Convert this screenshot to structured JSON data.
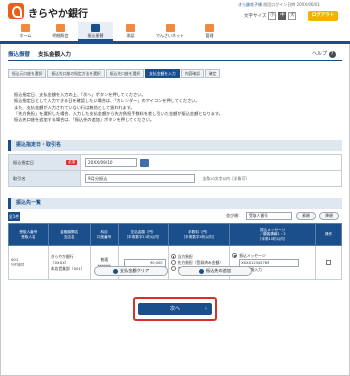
{
  "header": {
    "bank_name": "きらやか銀行",
    "user_name": "きら銀花子様",
    "last_login": "前回ログイン日時 20XX/06/01",
    "font_size_label": "文字サイズ",
    "font_sizes": [
      "小",
      "中",
      "大"
    ],
    "logout_label": "ログアウト"
  },
  "nav": {
    "items": [
      {
        "label": "ホーム",
        "icon": "home-icon"
      },
      {
        "label": "明細照会",
        "icon": "statement-icon"
      },
      {
        "label": "振込振替",
        "icon": "transfer-icon"
      },
      {
        "label": "承認",
        "icon": "approval-icon"
      },
      {
        "label": "でんさいネット",
        "icon": "densai-icon"
      },
      {
        "label": "管理",
        "icon": "admin-icon"
      }
    ]
  },
  "page": {
    "code": "振込振替",
    "title": "支払金額入力",
    "help_label": "ヘルプ"
  },
  "steps": [
    "振込元口座を選択",
    "振込先口座の指定方法を選択",
    "振込先口座を選択",
    "支払金額を入力",
    "内容確認",
    "確定"
  ],
  "instructions": [
    "振込指定日、支払金額を入力の上、「次へ」ボタンを押してください。",
    "振込指定日として入力できる日を確認したい場合は、「カレンダー」のアイコンを押してください。",
    "また、支払金額が入力されていない行は無効として扱われます。",
    "「先方負担」を選択した場合、入力した支払金額から先方負担手数料を差し引いた金額が振込金額となります。",
    "振込先口座を追加する場合は、「振込先の追加」ボタンを押してください。"
  ],
  "section_date": {
    "title": "振込指定日・取引名",
    "date_label": "振込指定日",
    "required_label": "必須",
    "date_value": "20XX/09/10",
    "txn_label": "取引名",
    "txn_value": "9月分振込",
    "txn_note": "全角10文字以内［半角可］"
  },
  "section_list": {
    "title": "振込先一覧",
    "all_label": "全1件",
    "sort_label": "並び順：",
    "sort_value": "受取人番号",
    "asc_label": "昇順",
    "desc_label": "降順",
    "headers": [
      "受取人番号\n受取人名",
      "金融機関名\n支店名",
      "科目\n口座番号",
      "支払金額（円）\n［半角数字11桁以内］",
      "手数料（円）\n［半角数字4桁以内］",
      "振込メッセージ\n／顧客情報1・2\n［半角10桁以内］",
      "操作"
    ],
    "rows": [
      {
        "receiver_no": "001",
        "receiver_name": "ｷﾗﾔｶﾀﾛｳ",
        "bank_name": "きらやか銀行（0XXX）",
        "branch_name": "本店営業部（001）",
        "account_type": "普通",
        "account_no": "*******",
        "amount": "90,000",
        "fee_option_1": "当方負担",
        "fee_option_2": "先方負担（登録済み金額）",
        "fee_option_3": "先方負担（指定金額）",
        "message_option_1": "振込メッセージ",
        "message_value": "XXXX12345789",
        "message_option_2": "顧客情報入力"
      }
    ]
  },
  "buttons": {
    "clear_label": "支払金額クリア",
    "add_label": "振込先の追加",
    "next_label": "次へ"
  }
}
